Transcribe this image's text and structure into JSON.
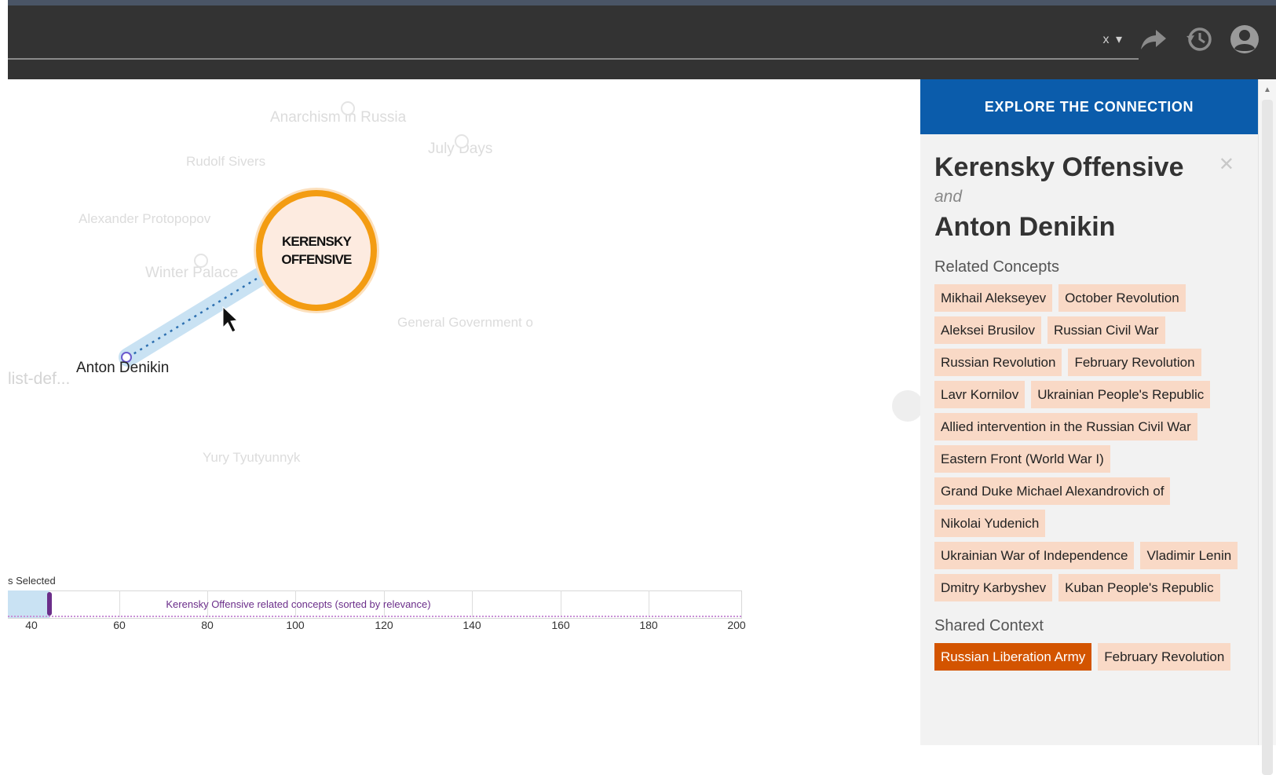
{
  "toolbar": {
    "dropdown_label": "x ▾",
    "icons": [
      "share-arrow-icon",
      "history-icon",
      "user-icon"
    ]
  },
  "graph": {
    "main_node": {
      "line1": "KERENSKY",
      "line2": "OFFENSIVE"
    },
    "selected_node": "Anton Denikin",
    "faded_nodes": [
      "Anarchism in Russia",
      "July Days",
      "Rudolf Sivers",
      "Alexander Protopopov",
      "Winter Palace",
      "General Government o",
      "Yury Tyutyunnyk",
      "list-def..."
    ],
    "colors": {
      "main_node_ring": "#f39c12",
      "main_node_fill": "#fdebe0",
      "link_highlight": "#c9e2f3",
      "link_dots": "#2c6fb0"
    }
  },
  "axis": {
    "selected_label": "s Selected",
    "caption": "Kerensky Offensive related concepts (sorted by relevance)",
    "ticks": [
      "40",
      "60",
      "80",
      "100",
      "120",
      "140",
      "160",
      "180",
      "200"
    ],
    "marker_color": "#6b2e8a"
  },
  "panel": {
    "header": "EXPLORE THE CONNECTION",
    "title_a": "Kerensky Offensive",
    "conjunction": "and",
    "title_b": "Anton Denikin",
    "related_heading": "Related Concepts",
    "related": [
      "Mikhail Alekseyev",
      "October Revolution",
      "Aleksei Brusilov",
      "Russian Civil War",
      "Russian Revolution",
      "February Revolution",
      "Lavr Kornilov",
      "Ukrainian People's Republic",
      "Allied intervention in the Russian Civil War",
      "Eastern Front (World War I)",
      "Grand Duke Michael Alexandrovich of",
      "Nikolai Yudenich",
      "Ukrainian War of Independence",
      "Vladimir Lenin",
      "Dmitry Karbyshev",
      "Kuban People's Republic"
    ],
    "shared_heading": "Shared Context",
    "shared": [
      {
        "label": "Russian Liberation Army",
        "active": true
      },
      {
        "label": "February Revolution",
        "active": false
      }
    ],
    "colors": {
      "header_bg": "#0b5cab",
      "tag_bg": "#f9d9c6",
      "tag_active_bg": "#d35400"
    }
  }
}
